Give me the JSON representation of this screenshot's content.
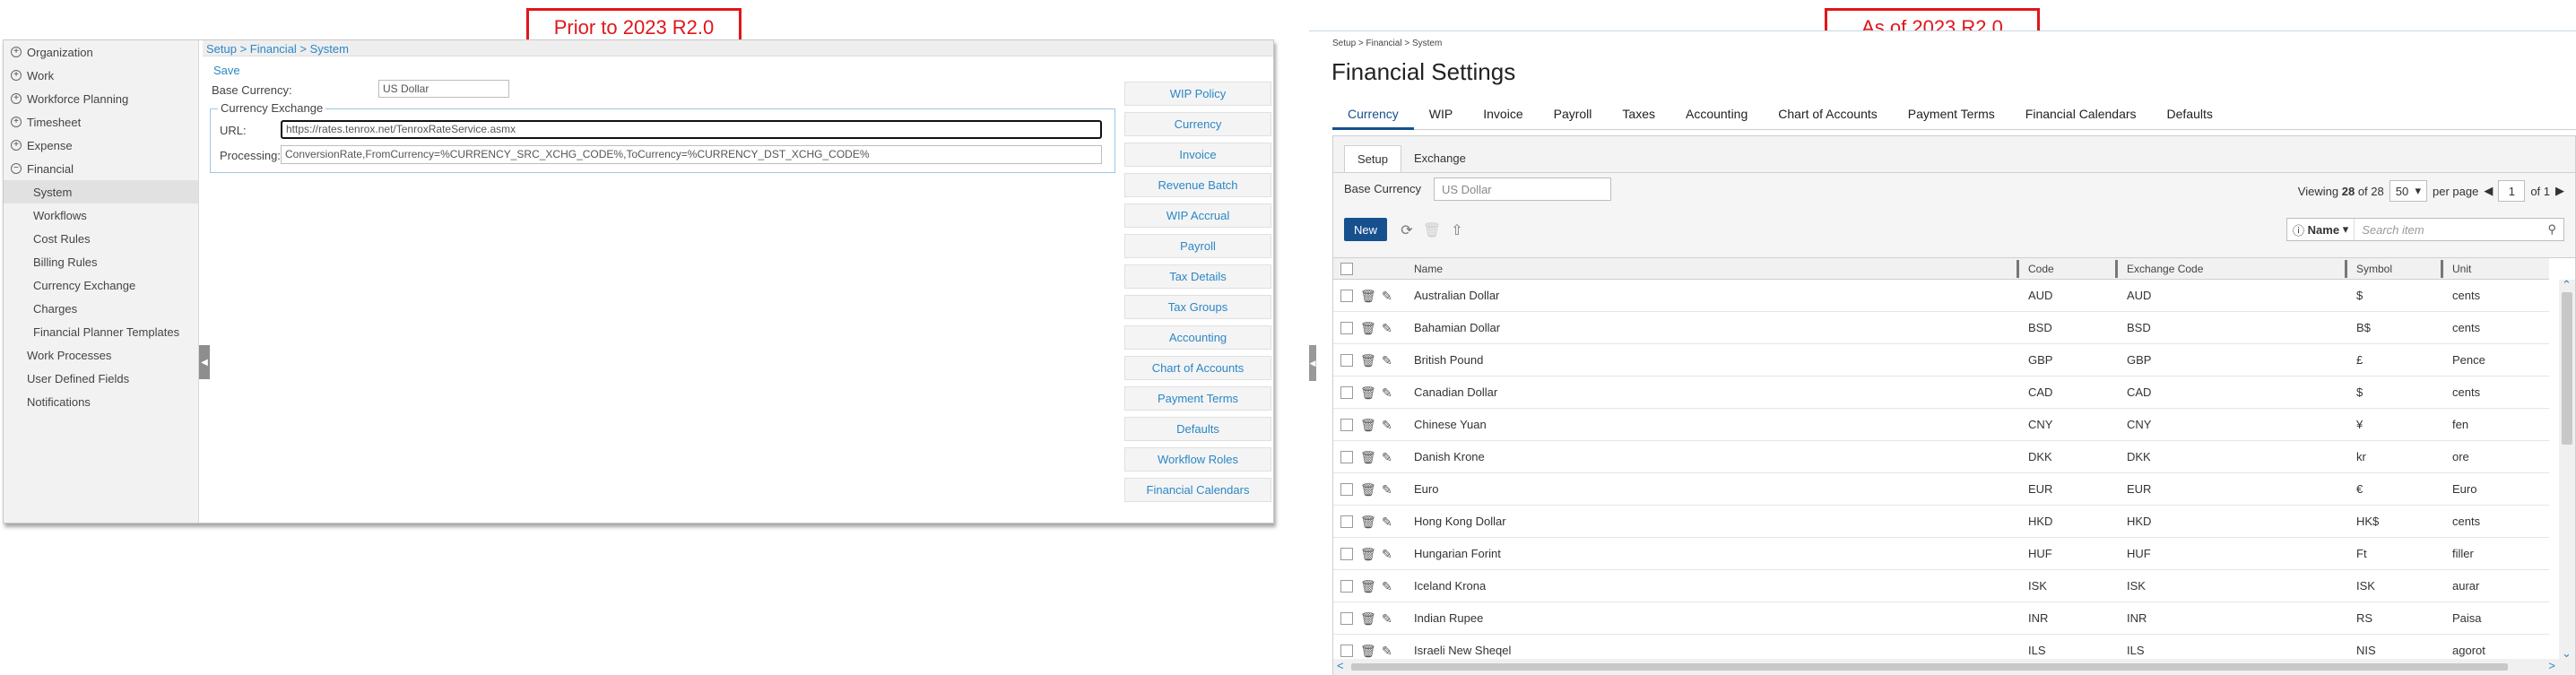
{
  "captions": {
    "left": "Prior to 2023 R2.0",
    "right": "As of 2023 R2.0"
  },
  "old_ui": {
    "nav": [
      {
        "label": "Organization",
        "type": "plus"
      },
      {
        "label": "Work",
        "type": "plus"
      },
      {
        "label": "Workforce Planning",
        "type": "plus"
      },
      {
        "label": "Timesheet",
        "type": "plus"
      },
      {
        "label": "Expense",
        "type": "plus"
      },
      {
        "label": "Financial",
        "type": "minus"
      },
      {
        "label": "System",
        "type": "sub",
        "active": true
      },
      {
        "label": "Workflows",
        "type": "sub"
      },
      {
        "label": "Cost Rules",
        "type": "sub"
      },
      {
        "label": "Billing Rules",
        "type": "sub"
      },
      {
        "label": "Currency Exchange",
        "type": "sub"
      },
      {
        "label": "Charges",
        "type": "sub"
      },
      {
        "label": "Financial Planner Templates",
        "type": "sub"
      },
      {
        "label": "Work Processes",
        "type": "noicon"
      },
      {
        "label": "User Defined Fields",
        "type": "noicon"
      },
      {
        "label": "Notifications",
        "type": "noicon"
      }
    ],
    "breadcrumb": "Setup > Financial > System",
    "save_label": "Save",
    "base_currency_label": "Base Currency:",
    "base_currency_value": "US Dollar",
    "currency_exchange_legend": "Currency Exchange",
    "url_label": "URL:",
    "url_value": "https://rates.tenrox.net/TenroxRateService.asmx",
    "processing_label": "Processing:",
    "processing_value": "ConversionRate,FromCurrency=%CURRENCY_SRC_XCHG_CODE%,ToCurrency=%CURRENCY_DST_XCHG_CODE%",
    "right_buttons": [
      "WIP Policy",
      "Currency",
      "Invoice",
      "Revenue Batch",
      "WIP Accrual",
      "Payroll",
      "Tax Details",
      "Tax Groups",
      "Accounting",
      "Chart of Accounts",
      "Payment Terms",
      "Defaults",
      "Workflow Roles",
      "Financial Calendars"
    ]
  },
  "new_ui": {
    "breadcrumb": "Setup > Financial > System",
    "title": "Financial Settings",
    "tabs": [
      "Currency",
      "WIP",
      "Invoice",
      "Payroll",
      "Taxes",
      "Accounting",
      "Chart of Accounts",
      "Payment Terms",
      "Financial Calendars",
      "Defaults"
    ],
    "active_tab": "Currency",
    "subtabs": [
      "Setup",
      "Exchange"
    ],
    "base_currency_label": "Base Currency",
    "base_currency_placeholder": "US Dollar",
    "viewing_prefix": "Viewing",
    "viewing_count": "28",
    "viewing_of": "of",
    "viewing_total": "28",
    "per_page_value": "50",
    "per_page_label": "per page",
    "page_value": "1",
    "page_of": "of 1",
    "new_button": "New",
    "search_field": "Name",
    "search_placeholder": "Search item",
    "columns": {
      "name": "Name",
      "code": "Code",
      "exchange_code": "Exchange Code",
      "symbol": "Symbol",
      "unit": "Unit"
    },
    "rows": [
      {
        "name": "Australian Dollar",
        "code": "AUD",
        "exchange_code": "AUD",
        "symbol": "$",
        "unit": "cents"
      },
      {
        "name": "Bahamian Dollar",
        "code": "BSD",
        "exchange_code": "BSD",
        "symbol": "B$",
        "unit": "cents"
      },
      {
        "name": "British Pound",
        "code": "GBP",
        "exchange_code": "GBP",
        "symbol": "£",
        "unit": "Pence"
      },
      {
        "name": "Canadian Dollar",
        "code": "CAD",
        "exchange_code": "CAD",
        "symbol": "$",
        "unit": "cents"
      },
      {
        "name": "Chinese Yuan",
        "code": "CNY",
        "exchange_code": "CNY",
        "symbol": "¥",
        "unit": "fen"
      },
      {
        "name": "Danish Krone",
        "code": "DKK",
        "exchange_code": "DKK",
        "symbol": "kr",
        "unit": "ore"
      },
      {
        "name": "Euro",
        "code": "EUR",
        "exchange_code": "EUR",
        "symbol": "€",
        "unit": "Euro"
      },
      {
        "name": "Hong Kong Dollar",
        "code": "HKD",
        "exchange_code": "HKD",
        "symbol": "HK$",
        "unit": "cents"
      },
      {
        "name": "Hungarian Forint",
        "code": "HUF",
        "exchange_code": "HUF",
        "symbol": "Ft",
        "unit": "filler"
      },
      {
        "name": "Iceland Krona",
        "code": "ISK",
        "exchange_code": "ISK",
        "symbol": "ISK",
        "unit": "aurar"
      },
      {
        "name": "Indian Rupee",
        "code": "INR",
        "exchange_code": "INR",
        "symbol": "RS",
        "unit": "Paisa"
      },
      {
        "name": "Israeli New Sheqel",
        "code": "ILS",
        "exchange_code": "ILS",
        "symbol": "NIS",
        "unit": "agorot"
      }
    ]
  }
}
